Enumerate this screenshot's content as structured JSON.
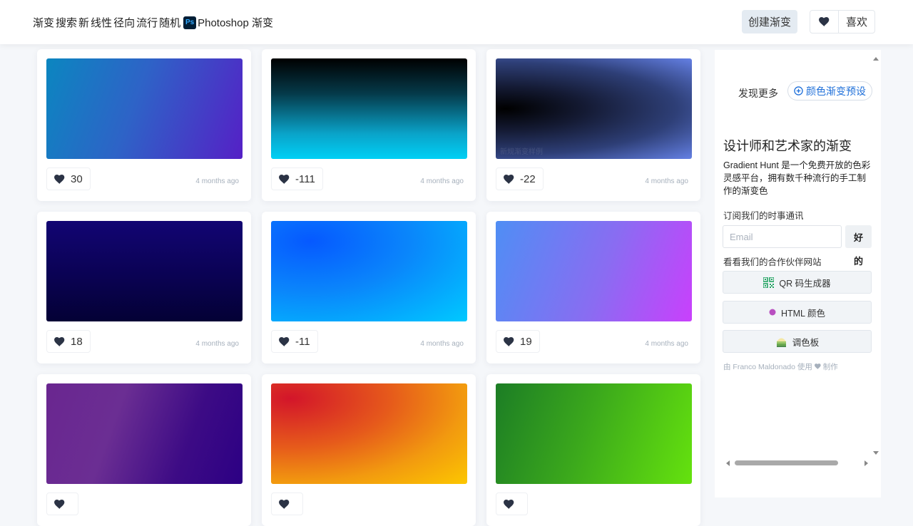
{
  "header": {
    "nav_items": [
      "渐变",
      "搜索",
      "新",
      "线性",
      "径向",
      "流行",
      "随机"
    ],
    "photoshop_label": "Photoshop 渐变",
    "ps_badge": "Ps",
    "create_label": "创建渐变",
    "favorites_label": "喜欢"
  },
  "cards": [
    {
      "likes": "30",
      "time": "4 months ago",
      "gradient": "linear-gradient(110deg, #0b86c0 0%, #2e63c7 45%, #5520c6 100%)"
    },
    {
      "likes": "-111",
      "time": "4 months ago",
      "gradient": "linear-gradient(180deg, #000000 0%, #053a4a 35%, #0aa3c9 75%, #00d0f5 100%)"
    },
    {
      "likes": "-22",
      "time": "4 months ago",
      "gradient": "radial-gradient(ellipse at 5% 50%, #000000 0%, #141a33 30%, #2e3f77 65%, #6480e4 100%)",
      "watermark": "新规渐变样例"
    },
    {
      "likes": "18",
      "time": "4 months ago",
      "gradient": "linear-gradient(180deg, #120573 0%, #0a0253 55%, #040135 100%)"
    },
    {
      "likes": "-11",
      "time": "4 months ago",
      "gradient": "radial-gradient(ellipse at 20% 20%, #0659ff 0%, #0a86fb 45%, #00c9ff 100%)"
    },
    {
      "likes": "19",
      "time": "4 months ago",
      "gradient": "linear-gradient(110deg, #4f8ef4 0%, #8a6cf2 55%, #c940fc 100%)"
    },
    {
      "likes": "",
      "time": "",
      "gradient": "linear-gradient(110deg, #6a2690 0%, #6b2e93 35%, #3d0b85 70%, #2c0084 100%)"
    },
    {
      "likes": "",
      "time": "",
      "gradient": "radial-gradient(ellipse at 10% 15%, #d3152a 0%, #e65a1b 40%, #f29a0f 70%, #fcc700 100%)"
    },
    {
      "likes": "",
      "time": "",
      "gradient": "linear-gradient(110deg, #1c7d25 0%, #3ba81c 45%, #65e20e 100%)"
    }
  ],
  "sidebar": {
    "discover_label": "发现更多",
    "preset_label": "颜色渐变预设",
    "title": "设计师和艺术家的渐变",
    "description": "Gradient Hunt 是一个免费开放的色彩灵感平台，拥有数千种流行的手工制作的渐变色",
    "subscribe_label": "订阅我们的时事通讯",
    "email_placeholder": "Email",
    "ok_label_1": "好",
    "ok_label_2": "的",
    "partners_label": "看看我们的合作伙伴网站",
    "partners": [
      {
        "label": "QR 码生成器",
        "icon": "qr-icon"
      },
      {
        "label": "HTML 颜色",
        "icon": "color-dot-icon"
      },
      {
        "label": "调色板",
        "icon": "palette-icon"
      }
    ],
    "credit_prefix": "由 Franco Maldonado 使用",
    "credit_suffix": "制作"
  },
  "colors": {
    "accent": "#1e6fd9",
    "heart": "#2b3345"
  }
}
